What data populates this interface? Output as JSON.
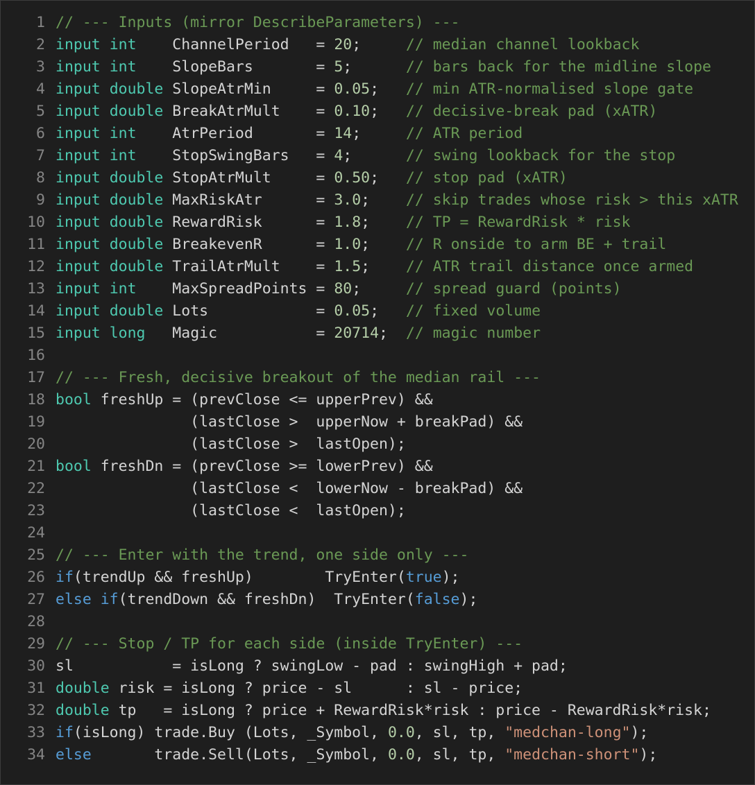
{
  "editor": {
    "colors": {
      "background": "#1e1e1e",
      "line_number": "#858585",
      "type_keyword": "#4ec9b0",
      "control_keyword": "#569cd6",
      "comment": "#6a9955",
      "number": "#b5cea8",
      "string": "#ce9178",
      "plain": "#d4d4d4"
    },
    "lines": [
      {
        "n": "1",
        "tokens": [
          {
            "t": "// --- Inputs (mirror DescribeParameters) ---",
            "k": "cm"
          }
        ]
      },
      {
        "n": "2",
        "tokens": [
          {
            "t": "input",
            "k": "kw"
          },
          {
            "t": " ",
            "k": "pl"
          },
          {
            "t": "int",
            "k": "kw"
          },
          {
            "t": "    ChannelPeriod   = ",
            "k": "pl"
          },
          {
            "t": "20",
            "k": "nu"
          },
          {
            "t": ";     ",
            "k": "pl"
          },
          {
            "t": "// median channel lookback",
            "k": "cm"
          }
        ]
      },
      {
        "n": "3",
        "tokens": [
          {
            "t": "input",
            "k": "kw"
          },
          {
            "t": " ",
            "k": "pl"
          },
          {
            "t": "int",
            "k": "kw"
          },
          {
            "t": "    SlopeBars       = ",
            "k": "pl"
          },
          {
            "t": "5",
            "k": "nu"
          },
          {
            "t": ";      ",
            "k": "pl"
          },
          {
            "t": "// bars back for the midline slope",
            "k": "cm"
          }
        ]
      },
      {
        "n": "4",
        "tokens": [
          {
            "t": "input",
            "k": "kw"
          },
          {
            "t": " ",
            "k": "pl"
          },
          {
            "t": "double",
            "k": "kw"
          },
          {
            "t": " SlopeAtrMin     = ",
            "k": "pl"
          },
          {
            "t": "0.05",
            "k": "nu"
          },
          {
            "t": ";   ",
            "k": "pl"
          },
          {
            "t": "// min ATR-normalised slope gate",
            "k": "cm"
          }
        ]
      },
      {
        "n": "5",
        "tokens": [
          {
            "t": "input",
            "k": "kw"
          },
          {
            "t": " ",
            "k": "pl"
          },
          {
            "t": "double",
            "k": "kw"
          },
          {
            "t": " BreakAtrMult    = ",
            "k": "pl"
          },
          {
            "t": "0.10",
            "k": "nu"
          },
          {
            "t": ";   ",
            "k": "pl"
          },
          {
            "t": "// decisive-break pad (xATR)",
            "k": "cm"
          }
        ]
      },
      {
        "n": "6",
        "tokens": [
          {
            "t": "input",
            "k": "kw"
          },
          {
            "t": " ",
            "k": "pl"
          },
          {
            "t": "int",
            "k": "kw"
          },
          {
            "t": "    AtrPeriod       = ",
            "k": "pl"
          },
          {
            "t": "14",
            "k": "nu"
          },
          {
            "t": ";     ",
            "k": "pl"
          },
          {
            "t": "// ATR period",
            "k": "cm"
          }
        ]
      },
      {
        "n": "7",
        "tokens": [
          {
            "t": "input",
            "k": "kw"
          },
          {
            "t": " ",
            "k": "pl"
          },
          {
            "t": "int",
            "k": "kw"
          },
          {
            "t": "    StopSwingBars   = ",
            "k": "pl"
          },
          {
            "t": "4",
            "k": "nu"
          },
          {
            "t": ";      ",
            "k": "pl"
          },
          {
            "t": "// swing lookback for the stop",
            "k": "cm"
          }
        ]
      },
      {
        "n": "8",
        "tokens": [
          {
            "t": "input",
            "k": "kw"
          },
          {
            "t": " ",
            "k": "pl"
          },
          {
            "t": "double",
            "k": "kw"
          },
          {
            "t": " StopAtrMult     = ",
            "k": "pl"
          },
          {
            "t": "0.50",
            "k": "nu"
          },
          {
            "t": ";   ",
            "k": "pl"
          },
          {
            "t": "// stop pad (xATR)",
            "k": "cm"
          }
        ]
      },
      {
        "n": "9",
        "tokens": [
          {
            "t": "input",
            "k": "kw"
          },
          {
            "t": " ",
            "k": "pl"
          },
          {
            "t": "double",
            "k": "kw"
          },
          {
            "t": " MaxRiskAtr      = ",
            "k": "pl"
          },
          {
            "t": "3.0",
            "k": "nu"
          },
          {
            "t": ";    ",
            "k": "pl"
          },
          {
            "t": "// skip trades whose risk > this xATR",
            "k": "cm"
          }
        ]
      },
      {
        "n": "10",
        "tokens": [
          {
            "t": "input",
            "k": "kw"
          },
          {
            "t": " ",
            "k": "pl"
          },
          {
            "t": "double",
            "k": "kw"
          },
          {
            "t": " RewardRisk      = ",
            "k": "pl"
          },
          {
            "t": "1.8",
            "k": "nu"
          },
          {
            "t": ";    ",
            "k": "pl"
          },
          {
            "t": "// TP = RewardRisk * risk",
            "k": "cm"
          }
        ]
      },
      {
        "n": "11",
        "tokens": [
          {
            "t": "input",
            "k": "kw"
          },
          {
            "t": " ",
            "k": "pl"
          },
          {
            "t": "double",
            "k": "kw"
          },
          {
            "t": " BreakevenR      = ",
            "k": "pl"
          },
          {
            "t": "1.0",
            "k": "nu"
          },
          {
            "t": ";    ",
            "k": "pl"
          },
          {
            "t": "// R onside to arm BE + trail",
            "k": "cm"
          }
        ]
      },
      {
        "n": "12",
        "tokens": [
          {
            "t": "input",
            "k": "kw"
          },
          {
            "t": " ",
            "k": "pl"
          },
          {
            "t": "double",
            "k": "kw"
          },
          {
            "t": " TrailAtrMult    = ",
            "k": "pl"
          },
          {
            "t": "1.5",
            "k": "nu"
          },
          {
            "t": ";    ",
            "k": "pl"
          },
          {
            "t": "// ATR trail distance once armed",
            "k": "cm"
          }
        ]
      },
      {
        "n": "13",
        "tokens": [
          {
            "t": "input",
            "k": "kw"
          },
          {
            "t": " ",
            "k": "pl"
          },
          {
            "t": "int",
            "k": "kw"
          },
          {
            "t": "    MaxSpreadPoints = ",
            "k": "pl"
          },
          {
            "t": "80",
            "k": "nu"
          },
          {
            "t": ";     ",
            "k": "pl"
          },
          {
            "t": "// spread guard (points)",
            "k": "cm"
          }
        ]
      },
      {
        "n": "14",
        "tokens": [
          {
            "t": "input",
            "k": "kw"
          },
          {
            "t": " ",
            "k": "pl"
          },
          {
            "t": "double",
            "k": "kw"
          },
          {
            "t": " Lots            = ",
            "k": "pl"
          },
          {
            "t": "0.05",
            "k": "nu"
          },
          {
            "t": ";   ",
            "k": "pl"
          },
          {
            "t": "// fixed volume",
            "k": "cm"
          }
        ]
      },
      {
        "n": "15",
        "tokens": [
          {
            "t": "input",
            "k": "kw"
          },
          {
            "t": " ",
            "k": "pl"
          },
          {
            "t": "long",
            "k": "kw"
          },
          {
            "t": "   Magic           = ",
            "k": "pl"
          },
          {
            "t": "20714",
            "k": "nu"
          },
          {
            "t": ";  ",
            "k": "pl"
          },
          {
            "t": "// magic number",
            "k": "cm"
          }
        ]
      },
      {
        "n": "16",
        "tokens": []
      },
      {
        "n": "17",
        "tokens": [
          {
            "t": "// --- Fresh, decisive breakout of the median rail ---",
            "k": "cm"
          }
        ]
      },
      {
        "n": "18",
        "tokens": [
          {
            "t": "bool",
            "k": "kw"
          },
          {
            "t": " freshUp = (prevClose <= upperPrev) &&",
            "k": "pl"
          }
        ]
      },
      {
        "n": "19",
        "tokens": [
          {
            "t": "               (lastClose >  upperNow + breakPad) &&",
            "k": "pl"
          }
        ]
      },
      {
        "n": "20",
        "tokens": [
          {
            "t": "               (lastClose >  lastOpen);",
            "k": "pl"
          }
        ]
      },
      {
        "n": "21",
        "tokens": [
          {
            "t": "bool",
            "k": "kw"
          },
          {
            "t": " freshDn = (prevClose >= lowerPrev) &&",
            "k": "pl"
          }
        ]
      },
      {
        "n": "22",
        "tokens": [
          {
            "t": "               (lastClose <  lowerNow - breakPad) &&",
            "k": "pl"
          }
        ]
      },
      {
        "n": "23",
        "tokens": [
          {
            "t": "               (lastClose <  lastOpen);",
            "k": "pl"
          }
        ]
      },
      {
        "n": "24",
        "tokens": []
      },
      {
        "n": "25",
        "tokens": [
          {
            "t": "// --- Enter with the trend, one side only ---",
            "k": "cm"
          }
        ]
      },
      {
        "n": "26",
        "tokens": [
          {
            "t": "if",
            "k": "fl"
          },
          {
            "t": "(trendUp && freshUp)        TryEnter(",
            "k": "pl"
          },
          {
            "t": "true",
            "k": "fl"
          },
          {
            "t": ");",
            "k": "pl"
          }
        ]
      },
      {
        "n": "27",
        "tokens": [
          {
            "t": "else",
            "k": "fl"
          },
          {
            "t": " ",
            "k": "pl"
          },
          {
            "t": "if",
            "k": "fl"
          },
          {
            "t": "(trendDown && freshDn)  TryEnter(",
            "k": "pl"
          },
          {
            "t": "false",
            "k": "fl"
          },
          {
            "t": ");",
            "k": "pl"
          }
        ]
      },
      {
        "n": "28",
        "tokens": []
      },
      {
        "n": "29",
        "tokens": [
          {
            "t": "// --- Stop / TP for each side (inside TryEnter) ---",
            "k": "cm"
          }
        ]
      },
      {
        "n": "30",
        "tokens": [
          {
            "t": "sl           = isLong ? swingLow - pad : swingHigh + pad;",
            "k": "pl"
          }
        ]
      },
      {
        "n": "31",
        "tokens": [
          {
            "t": "double",
            "k": "kw"
          },
          {
            "t": " risk = isLong ? price - sl      : sl - price;",
            "k": "pl"
          }
        ]
      },
      {
        "n": "32",
        "tokens": [
          {
            "t": "double",
            "k": "kw"
          },
          {
            "t": " tp   = isLong ? price + RewardRisk*risk : price - RewardRisk*risk;",
            "k": "pl"
          }
        ]
      },
      {
        "n": "33",
        "tokens": [
          {
            "t": "if",
            "k": "fl"
          },
          {
            "t": "(isLong) trade.Buy (Lots, _Symbol, ",
            "k": "pl"
          },
          {
            "t": "0.0",
            "k": "nu"
          },
          {
            "t": ", sl, tp, ",
            "k": "pl"
          },
          {
            "t": "\"medchan-long\"",
            "k": "st"
          },
          {
            "t": ");",
            "k": "pl"
          }
        ]
      },
      {
        "n": "34",
        "tokens": [
          {
            "t": "else",
            "k": "fl"
          },
          {
            "t": "       trade.Sell(Lots, _Symbol, ",
            "k": "pl"
          },
          {
            "t": "0.0",
            "k": "nu"
          },
          {
            "t": ", sl, tp, ",
            "k": "pl"
          },
          {
            "t": "\"medchan-short\"",
            "k": "st"
          },
          {
            "t": ");",
            "k": "pl"
          }
        ]
      }
    ]
  }
}
